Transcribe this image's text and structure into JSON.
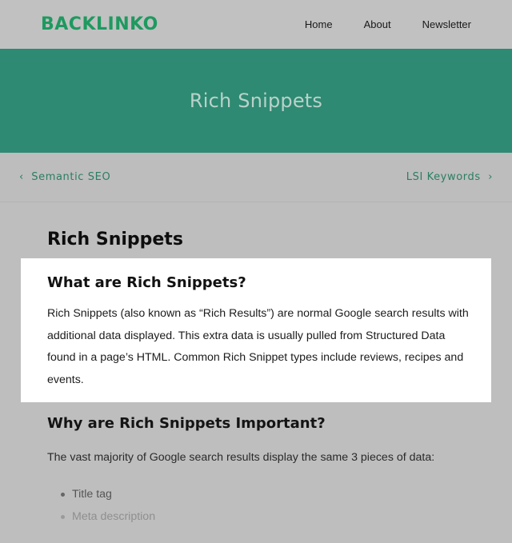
{
  "header": {
    "logo_text": "BACKLINKO",
    "nav": [
      {
        "label": "Home"
      },
      {
        "label": "About"
      },
      {
        "label": "Newsletter"
      }
    ]
  },
  "hero": {
    "title": "Rich Snippets"
  },
  "pager": {
    "prev_label": "Semantic SEO",
    "next_label": "LSI Keywords",
    "prev_icon": "chevron-left-icon",
    "next_icon": "chevron-right-icon"
  },
  "article": {
    "title": "Rich Snippets",
    "highlight": {
      "heading": "What are Rich Snippets?",
      "body": "Rich Snippets (also known as “Rich Results”) are normal Google search results with additional data displayed. This extra data is usually pulled from Structured Data found in a page’s HTML. Common Rich Snippet types include reviews, recipes and events."
    },
    "section2": {
      "heading": "Why are Rich Snippets Important?",
      "body": "The vast majority of Google search results display the same 3 pieces of data:",
      "bullets": [
        "Title tag",
        "Meta description"
      ]
    }
  },
  "colors": {
    "brand_green": "#1f9960",
    "hero_bg": "#2e8a72",
    "link_green": "#2b7d63"
  }
}
